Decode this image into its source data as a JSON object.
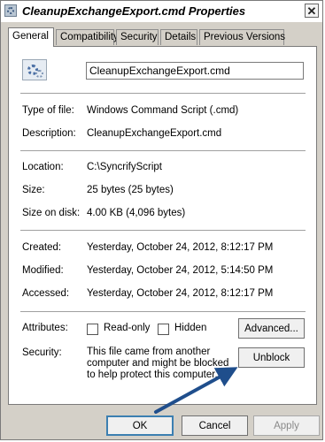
{
  "window": {
    "title": "CleanupExchangeExport.cmd Properties",
    "close_glyph": "✕"
  },
  "tabs": [
    {
      "label": "General",
      "active": true
    },
    {
      "label": "Compatibility",
      "active": false
    },
    {
      "label": "Security",
      "active": false
    },
    {
      "label": "Details",
      "active": false
    },
    {
      "label": "Previous Versions",
      "active": false
    }
  ],
  "general": {
    "file_name": "CleanupExchangeExport.cmd",
    "icon": "script-gear-icon",
    "type_label": "Type of file:",
    "type_value": "Windows Command Script (.cmd)",
    "description_label": "Description:",
    "description_value": "CleanupExchangeExport.cmd",
    "location_label": "Location:",
    "location_value": "C:\\SyncrifyScript",
    "size_label": "Size:",
    "size_value": "25 bytes (25 bytes)",
    "size_on_disk_label": "Size on disk:",
    "size_on_disk_value": "4.00 KB (4,096 bytes)",
    "created_label": "Created:",
    "created_value": "Yesterday, October 24, 2012, 8:12:17 PM",
    "modified_label": "Modified:",
    "modified_value": "Yesterday, October 24, 2012, 5:14:50 PM",
    "accessed_label": "Accessed:",
    "accessed_value": "Yesterday, October 24, 2012, 8:12:17 PM",
    "attributes_label": "Attributes:",
    "readonly_label": "Read-only",
    "readonly_checked": false,
    "hidden_label": "Hidden",
    "hidden_checked": false,
    "advanced_label": "Advanced...",
    "security_label": "Security:",
    "security_text": "This file came from another computer and might be blocked to help protect this computer.",
    "unblock_label": "Unblock"
  },
  "footer": {
    "ok_label": "OK",
    "cancel_label": "Cancel",
    "apply_label": "Apply"
  },
  "colors": {
    "annotation_arrow": "#1f4e8c",
    "dialog_face": "#d4d0c8",
    "default_button_border": "#3c7fb1"
  }
}
